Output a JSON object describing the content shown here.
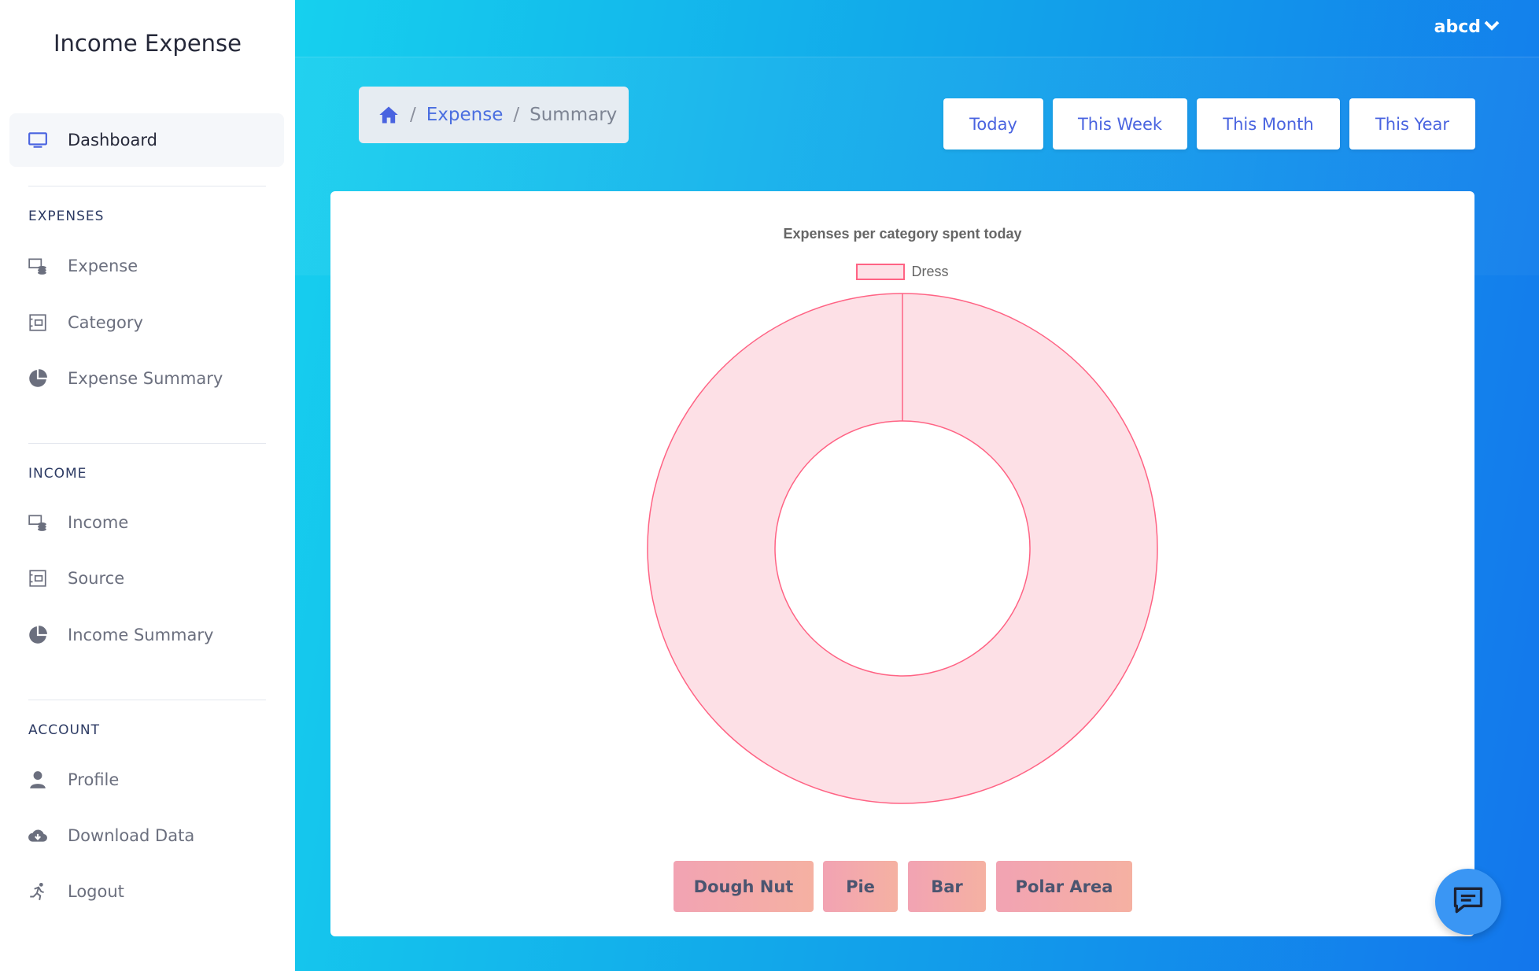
{
  "app": {
    "title": "Income Expense"
  },
  "sidebar": {
    "dashboard": {
      "label": "Dashboard",
      "icon": "monitor-icon"
    },
    "sections": [
      {
        "title": "EXPENSES",
        "items": [
          {
            "label": "Expense",
            "icon": "money-stack-icon"
          },
          {
            "label": "Category",
            "icon": "category-icon"
          },
          {
            "label": "Expense Summary",
            "icon": "pie-chart-icon"
          }
        ]
      },
      {
        "title": "INCOME",
        "items": [
          {
            "label": "Income",
            "icon": "money-stack-icon"
          },
          {
            "label": "Source",
            "icon": "source-icon"
          },
          {
            "label": "Income Summary",
            "icon": "pie-chart-icon"
          }
        ]
      },
      {
        "title": "ACCOUNT",
        "items": [
          {
            "label": "Profile",
            "icon": "user-icon"
          },
          {
            "label": "Download Data",
            "icon": "cloud-download-icon"
          },
          {
            "label": "Logout",
            "icon": "running-person-icon"
          }
        ]
      }
    ]
  },
  "header": {
    "user": "abcd"
  },
  "breadcrumb": {
    "home_icon": "home-icon",
    "items": [
      "Expense",
      "Summary"
    ]
  },
  "range_buttons": [
    "Today",
    "This Week",
    "This Month",
    "This Year"
  ],
  "chart_types": [
    "Dough Nut",
    "Pie",
    "Bar",
    "Polar Area"
  ],
  "colors": {
    "accent": "#4a64e0",
    "slice_fill": "#fde0e6",
    "slice_border": "#ff6384",
    "gradient_start": "#16d0ee",
    "gradient_end": "#1376ec"
  },
  "chart_data": {
    "type": "doughnut",
    "title": "Expenses per category spent today",
    "categories": [
      "Dress"
    ],
    "values": [
      1
    ],
    "legend_position": "top"
  }
}
